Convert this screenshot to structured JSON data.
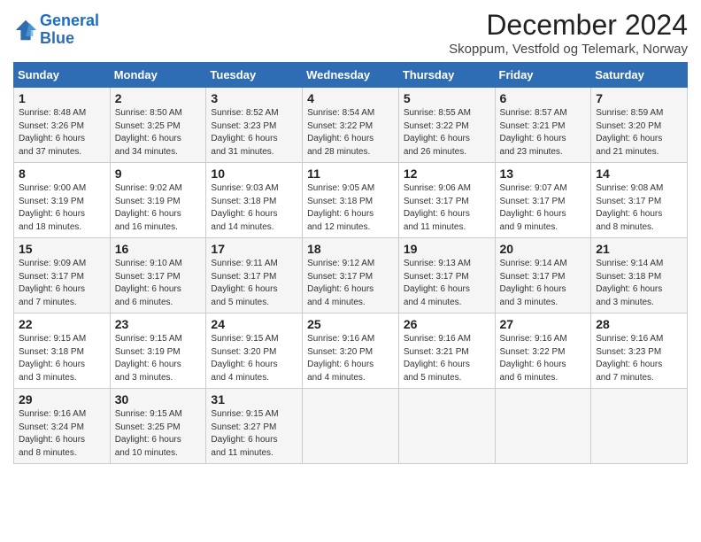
{
  "header": {
    "logo_line1": "General",
    "logo_line2": "Blue",
    "month": "December 2024",
    "location": "Skoppum, Vestfold og Telemark, Norway"
  },
  "days_of_week": [
    "Sunday",
    "Monday",
    "Tuesday",
    "Wednesday",
    "Thursday",
    "Friday",
    "Saturday"
  ],
  "weeks": [
    [
      {
        "day": "1",
        "info": "Sunrise: 8:48 AM\nSunset: 3:26 PM\nDaylight: 6 hours\nand 37 minutes."
      },
      {
        "day": "2",
        "info": "Sunrise: 8:50 AM\nSunset: 3:25 PM\nDaylight: 6 hours\nand 34 minutes."
      },
      {
        "day": "3",
        "info": "Sunrise: 8:52 AM\nSunset: 3:23 PM\nDaylight: 6 hours\nand 31 minutes."
      },
      {
        "day": "4",
        "info": "Sunrise: 8:54 AM\nSunset: 3:22 PM\nDaylight: 6 hours\nand 28 minutes."
      },
      {
        "day": "5",
        "info": "Sunrise: 8:55 AM\nSunset: 3:22 PM\nDaylight: 6 hours\nand 26 minutes."
      },
      {
        "day": "6",
        "info": "Sunrise: 8:57 AM\nSunset: 3:21 PM\nDaylight: 6 hours\nand 23 minutes."
      },
      {
        "day": "7",
        "info": "Sunrise: 8:59 AM\nSunset: 3:20 PM\nDaylight: 6 hours\nand 21 minutes."
      }
    ],
    [
      {
        "day": "8",
        "info": "Sunrise: 9:00 AM\nSunset: 3:19 PM\nDaylight: 6 hours\nand 18 minutes."
      },
      {
        "day": "9",
        "info": "Sunrise: 9:02 AM\nSunset: 3:19 PM\nDaylight: 6 hours\nand 16 minutes."
      },
      {
        "day": "10",
        "info": "Sunrise: 9:03 AM\nSunset: 3:18 PM\nDaylight: 6 hours\nand 14 minutes."
      },
      {
        "day": "11",
        "info": "Sunrise: 9:05 AM\nSunset: 3:18 PM\nDaylight: 6 hours\nand 12 minutes."
      },
      {
        "day": "12",
        "info": "Sunrise: 9:06 AM\nSunset: 3:17 PM\nDaylight: 6 hours\nand 11 minutes."
      },
      {
        "day": "13",
        "info": "Sunrise: 9:07 AM\nSunset: 3:17 PM\nDaylight: 6 hours\nand 9 minutes."
      },
      {
        "day": "14",
        "info": "Sunrise: 9:08 AM\nSunset: 3:17 PM\nDaylight: 6 hours\nand 8 minutes."
      }
    ],
    [
      {
        "day": "15",
        "info": "Sunrise: 9:09 AM\nSunset: 3:17 PM\nDaylight: 6 hours\nand 7 minutes."
      },
      {
        "day": "16",
        "info": "Sunrise: 9:10 AM\nSunset: 3:17 PM\nDaylight: 6 hours\nand 6 minutes."
      },
      {
        "day": "17",
        "info": "Sunrise: 9:11 AM\nSunset: 3:17 PM\nDaylight: 6 hours\nand 5 minutes."
      },
      {
        "day": "18",
        "info": "Sunrise: 9:12 AM\nSunset: 3:17 PM\nDaylight: 6 hours\nand 4 minutes."
      },
      {
        "day": "19",
        "info": "Sunrise: 9:13 AM\nSunset: 3:17 PM\nDaylight: 6 hours\nand 4 minutes."
      },
      {
        "day": "20",
        "info": "Sunrise: 9:14 AM\nSunset: 3:17 PM\nDaylight: 6 hours\nand 3 minutes."
      },
      {
        "day": "21",
        "info": "Sunrise: 9:14 AM\nSunset: 3:18 PM\nDaylight: 6 hours\nand 3 minutes."
      }
    ],
    [
      {
        "day": "22",
        "info": "Sunrise: 9:15 AM\nSunset: 3:18 PM\nDaylight: 6 hours\nand 3 minutes."
      },
      {
        "day": "23",
        "info": "Sunrise: 9:15 AM\nSunset: 3:19 PM\nDaylight: 6 hours\nand 3 minutes."
      },
      {
        "day": "24",
        "info": "Sunrise: 9:15 AM\nSunset: 3:20 PM\nDaylight: 6 hours\nand 4 minutes."
      },
      {
        "day": "25",
        "info": "Sunrise: 9:16 AM\nSunset: 3:20 PM\nDaylight: 6 hours\nand 4 minutes."
      },
      {
        "day": "26",
        "info": "Sunrise: 9:16 AM\nSunset: 3:21 PM\nDaylight: 6 hours\nand 5 minutes."
      },
      {
        "day": "27",
        "info": "Sunrise: 9:16 AM\nSunset: 3:22 PM\nDaylight: 6 hours\nand 6 minutes."
      },
      {
        "day": "28",
        "info": "Sunrise: 9:16 AM\nSunset: 3:23 PM\nDaylight: 6 hours\nand 7 minutes."
      }
    ],
    [
      {
        "day": "29",
        "info": "Sunrise: 9:16 AM\nSunset: 3:24 PM\nDaylight: 6 hours\nand 8 minutes."
      },
      {
        "day": "30",
        "info": "Sunrise: 9:15 AM\nSunset: 3:25 PM\nDaylight: 6 hours\nand 10 minutes."
      },
      {
        "day": "31",
        "info": "Sunrise: 9:15 AM\nSunset: 3:27 PM\nDaylight: 6 hours\nand 11 minutes."
      },
      {
        "day": "",
        "info": ""
      },
      {
        "day": "",
        "info": ""
      },
      {
        "day": "",
        "info": ""
      },
      {
        "day": "",
        "info": ""
      }
    ]
  ]
}
